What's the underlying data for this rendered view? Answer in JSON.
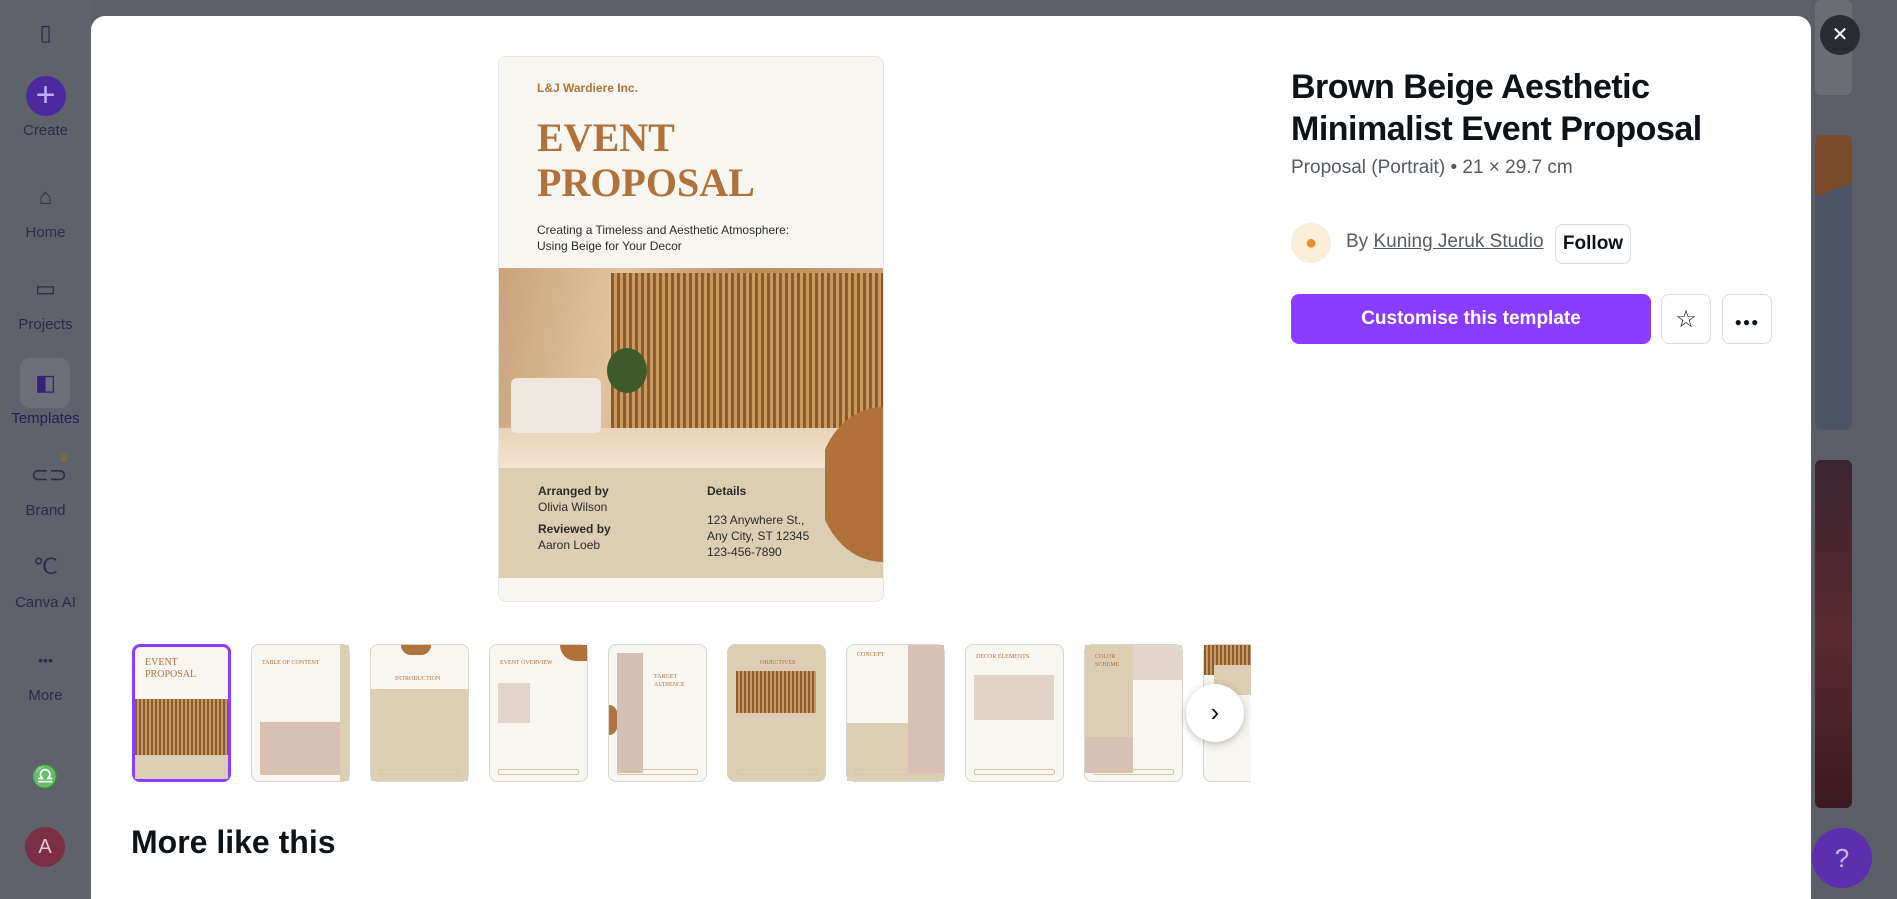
{
  "sidebar": {
    "items": [
      {
        "label": "Create",
        "icon": "plus-icon"
      },
      {
        "label": "Home",
        "icon": "home-icon"
      },
      {
        "label": "Projects",
        "icon": "folder-icon"
      },
      {
        "label": "Templates",
        "icon": "templates-icon"
      },
      {
        "label": "Brand",
        "icon": "brand-icon"
      },
      {
        "label": "Canva AI",
        "icon": "canva-ai-icon"
      },
      {
        "label": "More",
        "icon": "more-icon"
      }
    ],
    "avatar_letter": "A"
  },
  "preview": {
    "logo": "L&J Wardiere Inc.",
    "heading": "EVENT PROPOSAL",
    "subtitle": "Creating a Timeless and Aesthetic Atmosphere: Using Beige for Your Decor",
    "arranged_label": "Arranged by",
    "arranged_name": "Olivia Wilson",
    "reviewed_label": "Reviewed by",
    "reviewed_name": "Aaron Loeb",
    "details_label": "Details",
    "address1": "123 Anywhere St.,",
    "address2": "Any City, ST 12345",
    "phone": "123-456-7890"
  },
  "template": {
    "title": "Brown Beige Aesthetic Minimalist Event Proposal",
    "meta": "Proposal (Portrait) • 21 × 29.7 cm",
    "by": "By",
    "author": "Kuning Jeruk Studio",
    "follow": "Follow",
    "customise": "Customise this template"
  },
  "thumbnails": [
    {
      "title": "EVENT PROPOSAL"
    },
    {
      "title": "TABLE OF CONTENT"
    },
    {
      "title": "INTRODUCTION"
    },
    {
      "title": "EVENT OVERVIEW"
    },
    {
      "title": "TARGET AUDIENCE"
    },
    {
      "title": "OBJECTIVES"
    },
    {
      "title": "CONCEPT"
    },
    {
      "title": "DECOR ELEMENTS"
    },
    {
      "title": "COLOR SCHEME"
    },
    {
      "title": ""
    }
  ],
  "more_like_this": "More like this",
  "help": "?",
  "colors": {
    "accent": "#8b3dff",
    "brown": "#b0723a",
    "beige": "#dcceb3"
  }
}
